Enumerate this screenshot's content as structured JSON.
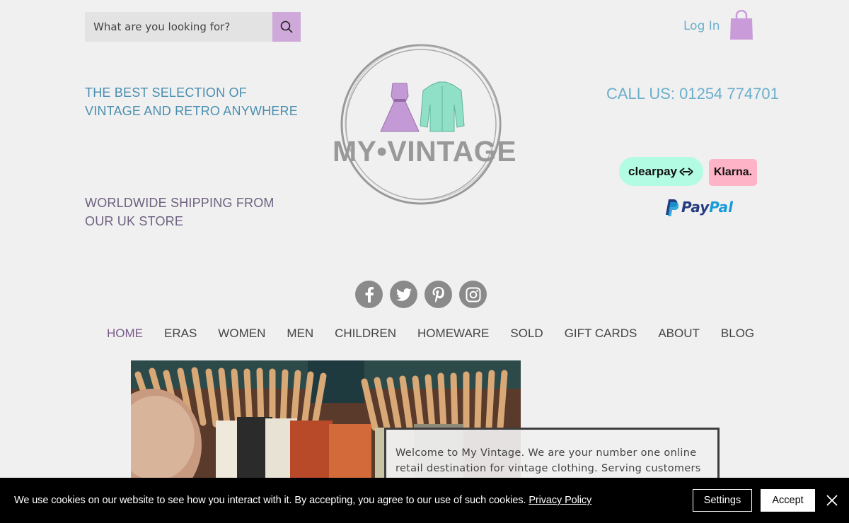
{
  "search": {
    "placeholder": "What are you looking for?"
  },
  "header": {
    "login_label": "Log In",
    "tagline_primary": "THE BEST SELECTION OF VINTAGE AND RETRO ANYWHERE",
    "tagline_shipping": "WORLDWIDE SHIPPING FROM OUR UK STORE",
    "call_us": "CALL US: 01254 774701",
    "logo_text": "MY•VINTAGE"
  },
  "payments": {
    "clearpay": "clearpay",
    "klarna": "Klarna.",
    "paypal_a": "Pay",
    "paypal_b": "Pal"
  },
  "social": [
    {
      "icon": "facebook-icon"
    },
    {
      "icon": "twitter-icon"
    },
    {
      "icon": "pinterest-icon"
    },
    {
      "icon": "instagram-icon"
    }
  ],
  "nav": {
    "items": [
      {
        "label": "HOME"
      },
      {
        "label": "ERAS"
      },
      {
        "label": "WOMEN"
      },
      {
        "label": "MEN"
      },
      {
        "label": "CHILDREN"
      },
      {
        "label": "HOMEWARE"
      },
      {
        "label": "SOLD"
      },
      {
        "label": "GIFT CARDS"
      },
      {
        "label": "ABOUT"
      },
      {
        "label": "BLOG"
      }
    ],
    "active": "HOME"
  },
  "welcome": {
    "text": "Welcome to My Vintage. We are your number one online retail destination for vintage clothing. Serving customers"
  },
  "cookie": {
    "text": "We use cookies on our website to see how you interact with it. By accepting, you agree to our use of such cookies.",
    "policy_link": "Privacy Policy",
    "settings_label": "Settings",
    "accept_label": "Accept"
  },
  "colors": {
    "accent_purple": "#cfa9da",
    "accent_blue": "#6aaecc",
    "clearpay": "#b2fce4",
    "klarna": "#ffb3c7"
  }
}
